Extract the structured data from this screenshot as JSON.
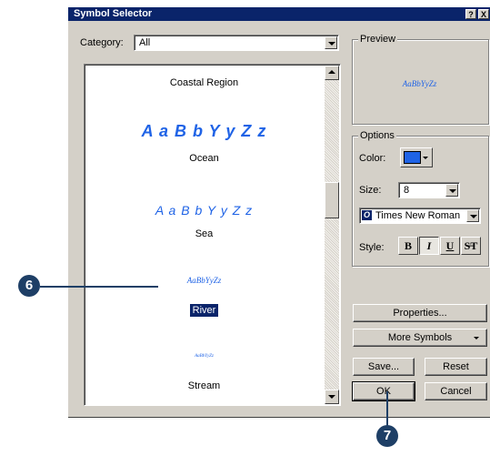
{
  "dialog": {
    "title": "Symbol Selector",
    "help_glyph": "?",
    "close_glyph": "X"
  },
  "category": {
    "label": "Category:",
    "value": "All"
  },
  "symbols": [
    {
      "name": "Coastal Region",
      "sample": ""
    },
    {
      "name": "Ocean",
      "sample": "A a B b Y y Z z"
    },
    {
      "name": "Sea",
      "sample": "A a B b Y y Z z"
    },
    {
      "name": "River",
      "sample": "AaBbYyZz",
      "selected": true
    },
    {
      "name": "Stream",
      "sample": "AaBbYyZz"
    }
  ],
  "preview": {
    "label": "Preview",
    "sample": "AaBbYyZz"
  },
  "options": {
    "label": "Options",
    "color_label": "Color:",
    "color_value": "#1f63e6",
    "size_label": "Size:",
    "size_value": "8",
    "font_icon": "O",
    "font_value": "Times New Roman",
    "style_label": "Style:",
    "style_buttons": [
      "B",
      "I",
      "U",
      "S̶T"
    ]
  },
  "buttons": {
    "properties": "Properties...",
    "more_symbols": "More Symbols",
    "save": "Save...",
    "reset": "Reset",
    "ok": "OK",
    "cancel": "Cancel"
  },
  "callouts": {
    "c6": "6",
    "c7": "7"
  },
  "colors": {
    "callout": "#1e3f66",
    "symbol_blue": "#1f63e6",
    "title_bar": "#0a246a"
  }
}
